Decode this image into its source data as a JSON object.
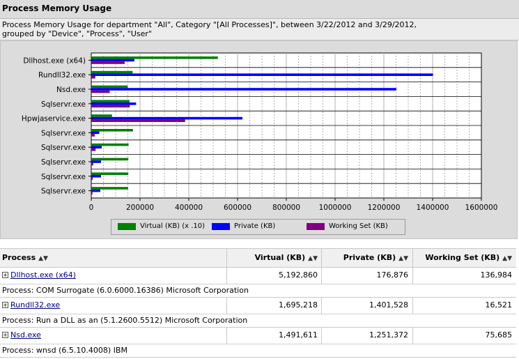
{
  "page": {
    "title": "Process Memory Usage",
    "description": "Process Memory Usage for department \"All\", Category \"[All Processes]\", between 3/22/2012 and 3/29/2012, grouped by \"Device\", \"Process\", \"User\""
  },
  "chart_data": {
    "type": "bar",
    "orientation": "horizontal",
    "categories": [
      "Dllhost.exe (x64)",
      "Rundll32.exe",
      "Nsd.exe",
      "Sqlservr.exe",
      "Hpwjaservice.exe",
      "Sqlservr.exe",
      "Sqlservr.exe",
      "Sqlservr.exe",
      "Sqlservr.exe",
      "Sqlservr.exe"
    ],
    "series": [
      {
        "name": "Virtual (KB) (x .10)",
        "color": "#008000",
        "values": [
          519286,
          169522,
          149161,
          157000,
          85000,
          171000,
          153000,
          152000,
          152000,
          151000
        ]
      },
      {
        "name": "Private (KB)",
        "color": "#0000ff",
        "values": [
          176876,
          1401528,
          1251372,
          184000,
          620000,
          33000,
          43000,
          40000,
          40000,
          37000
        ]
      },
      {
        "name": "Working Set (KB)",
        "color": "#800080",
        "values": [
          136984,
          16521,
          75685,
          158000,
          385000,
          14000,
          18000,
          8000,
          6000,
          5000
        ]
      }
    ],
    "xlim": [
      0,
      1600000
    ],
    "xticks": [
      "0",
      "200000",
      "400000",
      "600000",
      "800000",
      "1000000",
      "1200000",
      "1400000",
      "1600000"
    ],
    "grid": true,
    "legend": "bottom"
  },
  "table": {
    "columns": [
      {
        "label": "Process"
      },
      {
        "label": "Virtual (KB)"
      },
      {
        "label": "Private (KB)"
      },
      {
        "label": "Working Set (KB)"
      }
    ],
    "rows": [
      {
        "name": "Dllhost.exe (x64)",
        "virtual": "5,192,860",
        "private": "176,876",
        "working": "136,984",
        "info": "Process: COM Surrogate (6.0.6000.16386) Microsoft Corporation"
      },
      {
        "name": "Rundll32.exe",
        "virtual": "1,695,218",
        "private": "1,401,528",
        "working": "16,521",
        "info": "Process: Run a DLL as an (5.1.2600.5512) Microsoft Corporation"
      },
      {
        "name": "Nsd.exe",
        "virtual": "1,491,611",
        "private": "1,251,372",
        "working": "75,685",
        "info": "Process: wnsd (6.5.10.4008) IBM"
      }
    ]
  }
}
